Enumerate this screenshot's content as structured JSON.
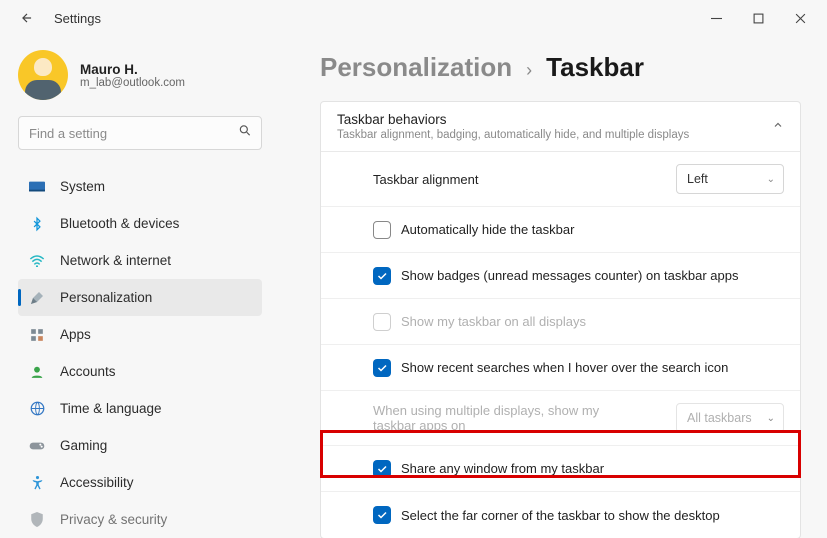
{
  "window": {
    "title": "Settings"
  },
  "user": {
    "name": "Mauro H.",
    "email": "m_lab@outlook.com"
  },
  "search": {
    "placeholder": "Find a setting"
  },
  "nav": {
    "items": [
      {
        "label": "System"
      },
      {
        "label": "Bluetooth & devices"
      },
      {
        "label": "Network & internet"
      },
      {
        "label": "Personalization"
      },
      {
        "label": "Apps"
      },
      {
        "label": "Accounts"
      },
      {
        "label": "Time & language"
      },
      {
        "label": "Gaming"
      },
      {
        "label": "Accessibility"
      },
      {
        "label": "Privacy & security"
      }
    ]
  },
  "breadcrumb": {
    "parent": "Personalization",
    "current": "Taskbar"
  },
  "panel": {
    "title": "Taskbar behaviors",
    "subtitle": "Taskbar alignment, badging, automatically hide, and multiple displays",
    "rows": {
      "alignment": {
        "label": "Taskbar alignment",
        "value": "Left"
      },
      "autohide": {
        "label": "Automatically hide the taskbar"
      },
      "badges": {
        "label": "Show badges (unread messages counter) on taskbar apps"
      },
      "alldisplays": {
        "label": "Show my taskbar on all displays"
      },
      "recentsearch": {
        "label": "Show recent searches when I hover over the search icon"
      },
      "multidisplay": {
        "label": "When using multiple displays, show my taskbar apps on",
        "value": "All taskbars"
      },
      "shareany": {
        "label": "Share any window from my taskbar"
      },
      "farcorner": {
        "label": "Select the far corner of the taskbar to show the desktop"
      }
    }
  }
}
